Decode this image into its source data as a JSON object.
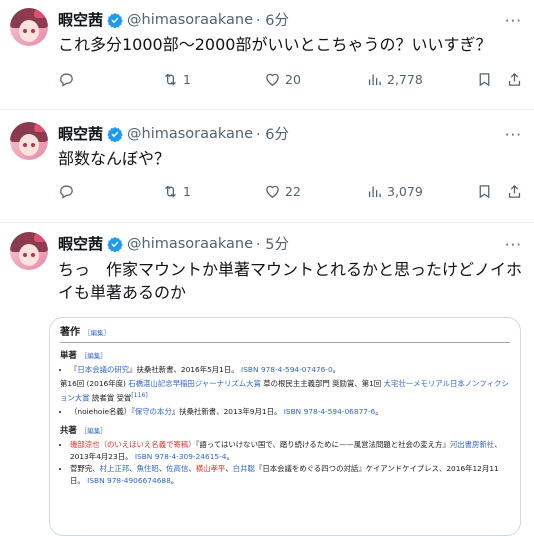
{
  "tweets": [
    {
      "name": "暇空茜",
      "handle": "@himasoraakane",
      "time": "· 6分",
      "text": "これ多分1000部〜2000部がいいとこちゃうの？いいすぎ？",
      "retweets": "1",
      "likes": "20",
      "views": "2,778"
    },
    {
      "name": "暇空茜",
      "handle": "@himasoraakane",
      "time": "· 6分",
      "text": "部数なんぼや？",
      "retweets": "1",
      "likes": "22",
      "views": "3,079"
    },
    {
      "name": "暇空茜",
      "handle": "@himasoraakane",
      "time": "· 5分",
      "text": "ちっ　作家マウントか単著マウントとれるかと思ったけどノイホイも単著あるのか"
    }
  ],
  "more_glyph": "···",
  "embed": {
    "heading": "著作",
    "edit_label": "［編集］",
    "section_single": "単著",
    "single_items": [
      {
        "pre": "『",
        "title": "日本会議の研究",
        "post": "』扶桑社新書、2016年5月1日。",
        "isbn_label": "ISBN",
        "isbn": "978-4-594-07476-0",
        "end": "。"
      }
    ],
    "award_para": {
      "pre": "第16回 (2016年度) ",
      "award1": "石橋湛山記念早稲田ジャーナリズム大賞",
      "mid": " 草の根民主主義部門 奨励賞、第1回 ",
      "award2": "大宅壮一メモリアル日本ノンフィクション大賞",
      "post": " 読者賞 受賞",
      "ref": "[116]"
    },
    "single_items2": [
      {
        "pre": "（noiehoie名義）『",
        "title": "保守の本分",
        "post": "』扶桑社新書、2013年9月1日。",
        "isbn_label": "ISBN",
        "isbn": "978-4-594-06877-6",
        "end": "。"
      }
    ],
    "section_joint": "共著",
    "joint_1": {
      "a1": "磯部涼也（のいえほいえ名義で寄稿）",
      "mid": "『語ってはいけない国で、踏り続けるために——風営法問題と社会の変え方』",
      "pub": "河出書房新社",
      "date": "、2013年4月23日。",
      "isbn_label": "ISBN",
      "isbn": "978-4-309-24615-4",
      "end": "。"
    },
    "joint_2": {
      "pre": "菅野完、",
      "a1": "村上正邦",
      "s1": "、",
      "a2": "魚住昭",
      "s2": "、",
      "a3": "佐高信",
      "s3": "、",
      "a4": "横山孝平",
      "s4": "、",
      "a5": "白井聡",
      "post": "『日本会議をめぐる四つの対話』ケイアンドケイプレス、2016年12月11日。",
      "isbn_label": "ISBN",
      "isbn": "978-4906674688",
      "end": "。"
    }
  },
  "colors": {
    "verified": "#1d9bf0",
    "link": "#3366cc",
    "muted": "#536471"
  }
}
